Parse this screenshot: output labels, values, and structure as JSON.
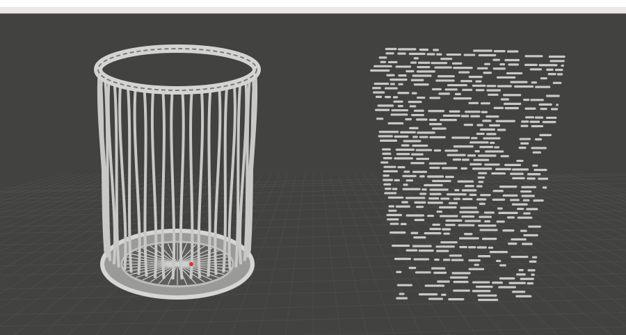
{
  "colors": {
    "background": "#424240",
    "toolbar": "#ece7e4",
    "grid": "#5a5a58",
    "model": "#c8c8c6",
    "marker": "#e03030"
  },
  "scene": {
    "models": [
      {
        "name": "lattice-cylinder-mesh"
      },
      {
        "name": "voxel-point-cloud"
      }
    ]
  }
}
